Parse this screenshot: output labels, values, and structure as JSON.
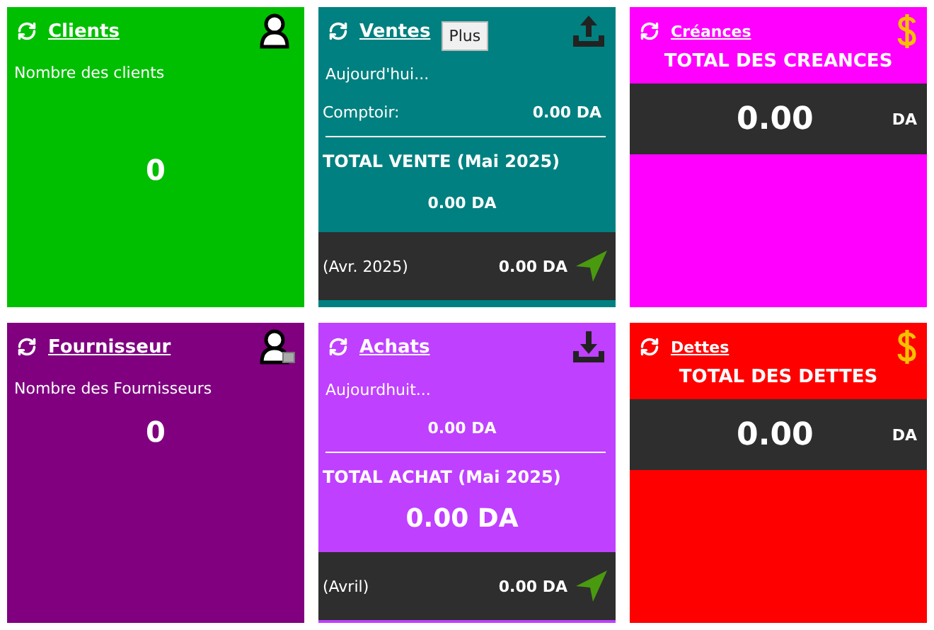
{
  "tiles": [
    {
      "kind": "clients",
      "color": "#00bf00",
      "title": "Clients",
      "label": "Nombre des clients",
      "count": "0"
    },
    {
      "kind": "sales",
      "color": "#008080",
      "title": "Ventes",
      "plus_button": "Plus",
      "today_label": "Aujourd'hui...",
      "today_row": {
        "label": "Comptoir:",
        "amount": "0.00 DA"
      },
      "total_title": "TOTAL VENTE (Mai 2025)",
      "total_amount": "0.00 DA",
      "large_total": false,
      "previous": {
        "label": "(Avr. 2025)",
        "amount": "0.00 DA"
      }
    },
    {
      "kind": "receivables",
      "color": "#ff00ff",
      "title": "Créances",
      "total_title": "TOTAL DES CREANCES",
      "amount": "0.00",
      "currency": "DA"
    },
    {
      "kind": "suppliers",
      "color": "#800080",
      "title": "Fournisseur",
      "label": "Nombre des Fournisseurs",
      "count": "0"
    },
    {
      "kind": "purchases",
      "color": "#bf40ff",
      "title": "Achats",
      "today_label": "Aujourdhuit...",
      "today_row": {
        "amount": "0.00 DA"
      },
      "total_title": "TOTAL ACHAT (Mai 2025)",
      "total_amount": "0.00 DA",
      "large_total": true,
      "previous": {
        "label": "(Avril)",
        "amount": "0.00 DA"
      }
    },
    {
      "kind": "debts",
      "color": "#ff0000",
      "title": "Dettes",
      "total_title": "TOTAL DES DETTES",
      "amount": "0.00",
      "currency": "DA"
    }
  ]
}
